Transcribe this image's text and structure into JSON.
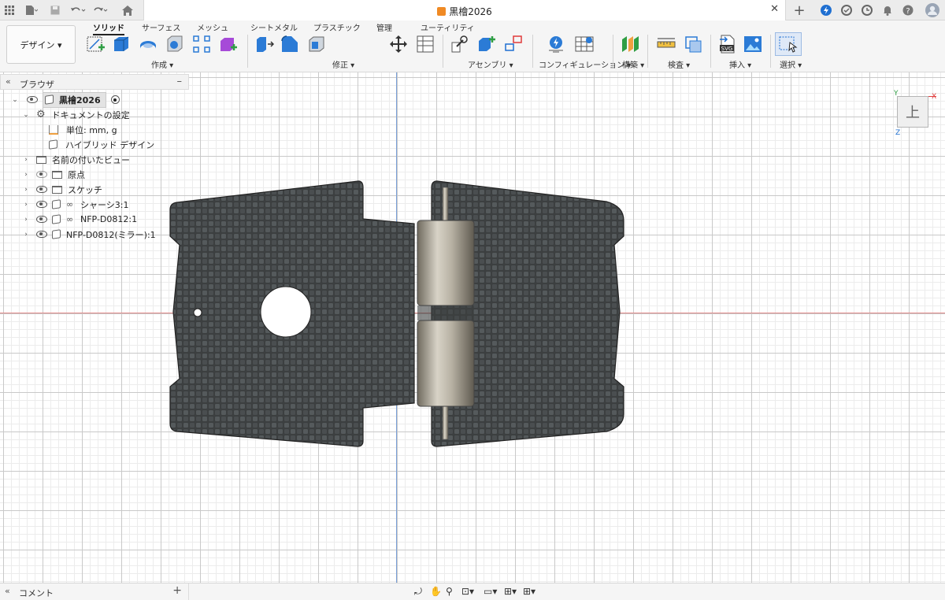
{
  "titlebar": {
    "document_title": "黒檜2026",
    "icons": [
      "grid-icon",
      "file-icon",
      "save-icon",
      "undo-icon",
      "redo-icon",
      "home-icon",
      "close-icon",
      "plus-icon",
      "online-icon",
      "job-status-icon",
      "clock-icon",
      "bell-icon",
      "help-icon",
      "user-icon"
    ]
  },
  "ribbon": {
    "workspace": "デザイン ▾",
    "tabs": [
      "ソリッド",
      "サーフェス",
      "メッシュ",
      "シートメタル",
      "プラスチック",
      "管理",
      "ユーティリティ"
    ],
    "active_tab": 0,
    "groups": [
      "作成 ▾",
      "修正 ▾",
      "アセンブリ ▾",
      "コンフィギュレーション ▾",
      "構築 ▾",
      "検査 ▾",
      "挿入 ▾",
      "選択 ▾"
    ],
    "insert_svg_label": "SVG",
    "colors": {
      "accent": "#1f6fd1",
      "green": "#2f9e44",
      "purple": "#a64ad8"
    }
  },
  "browser": {
    "title": "ブラウザ",
    "items": [
      {
        "label": "黒檜2026"
      },
      {
        "label": "ドキュメントの設定"
      },
      {
        "label": "単位: mm, g"
      },
      {
        "label": "ハイブリッド デザイン"
      },
      {
        "label": "名前の付いたビュー"
      },
      {
        "label": "原点"
      },
      {
        "label": "スケッチ"
      },
      {
        "label": "シャーシ3:1"
      },
      {
        "label": "NFP-D0812:1"
      },
      {
        "label": "NFP-D0812(ミラー):1"
      }
    ]
  },
  "viewcube": {
    "face": "上",
    "x_label": "X",
    "y_label": "Y",
    "z_label": "Z"
  },
  "bottom": {
    "comment_label": "コメント",
    "add": "+"
  }
}
